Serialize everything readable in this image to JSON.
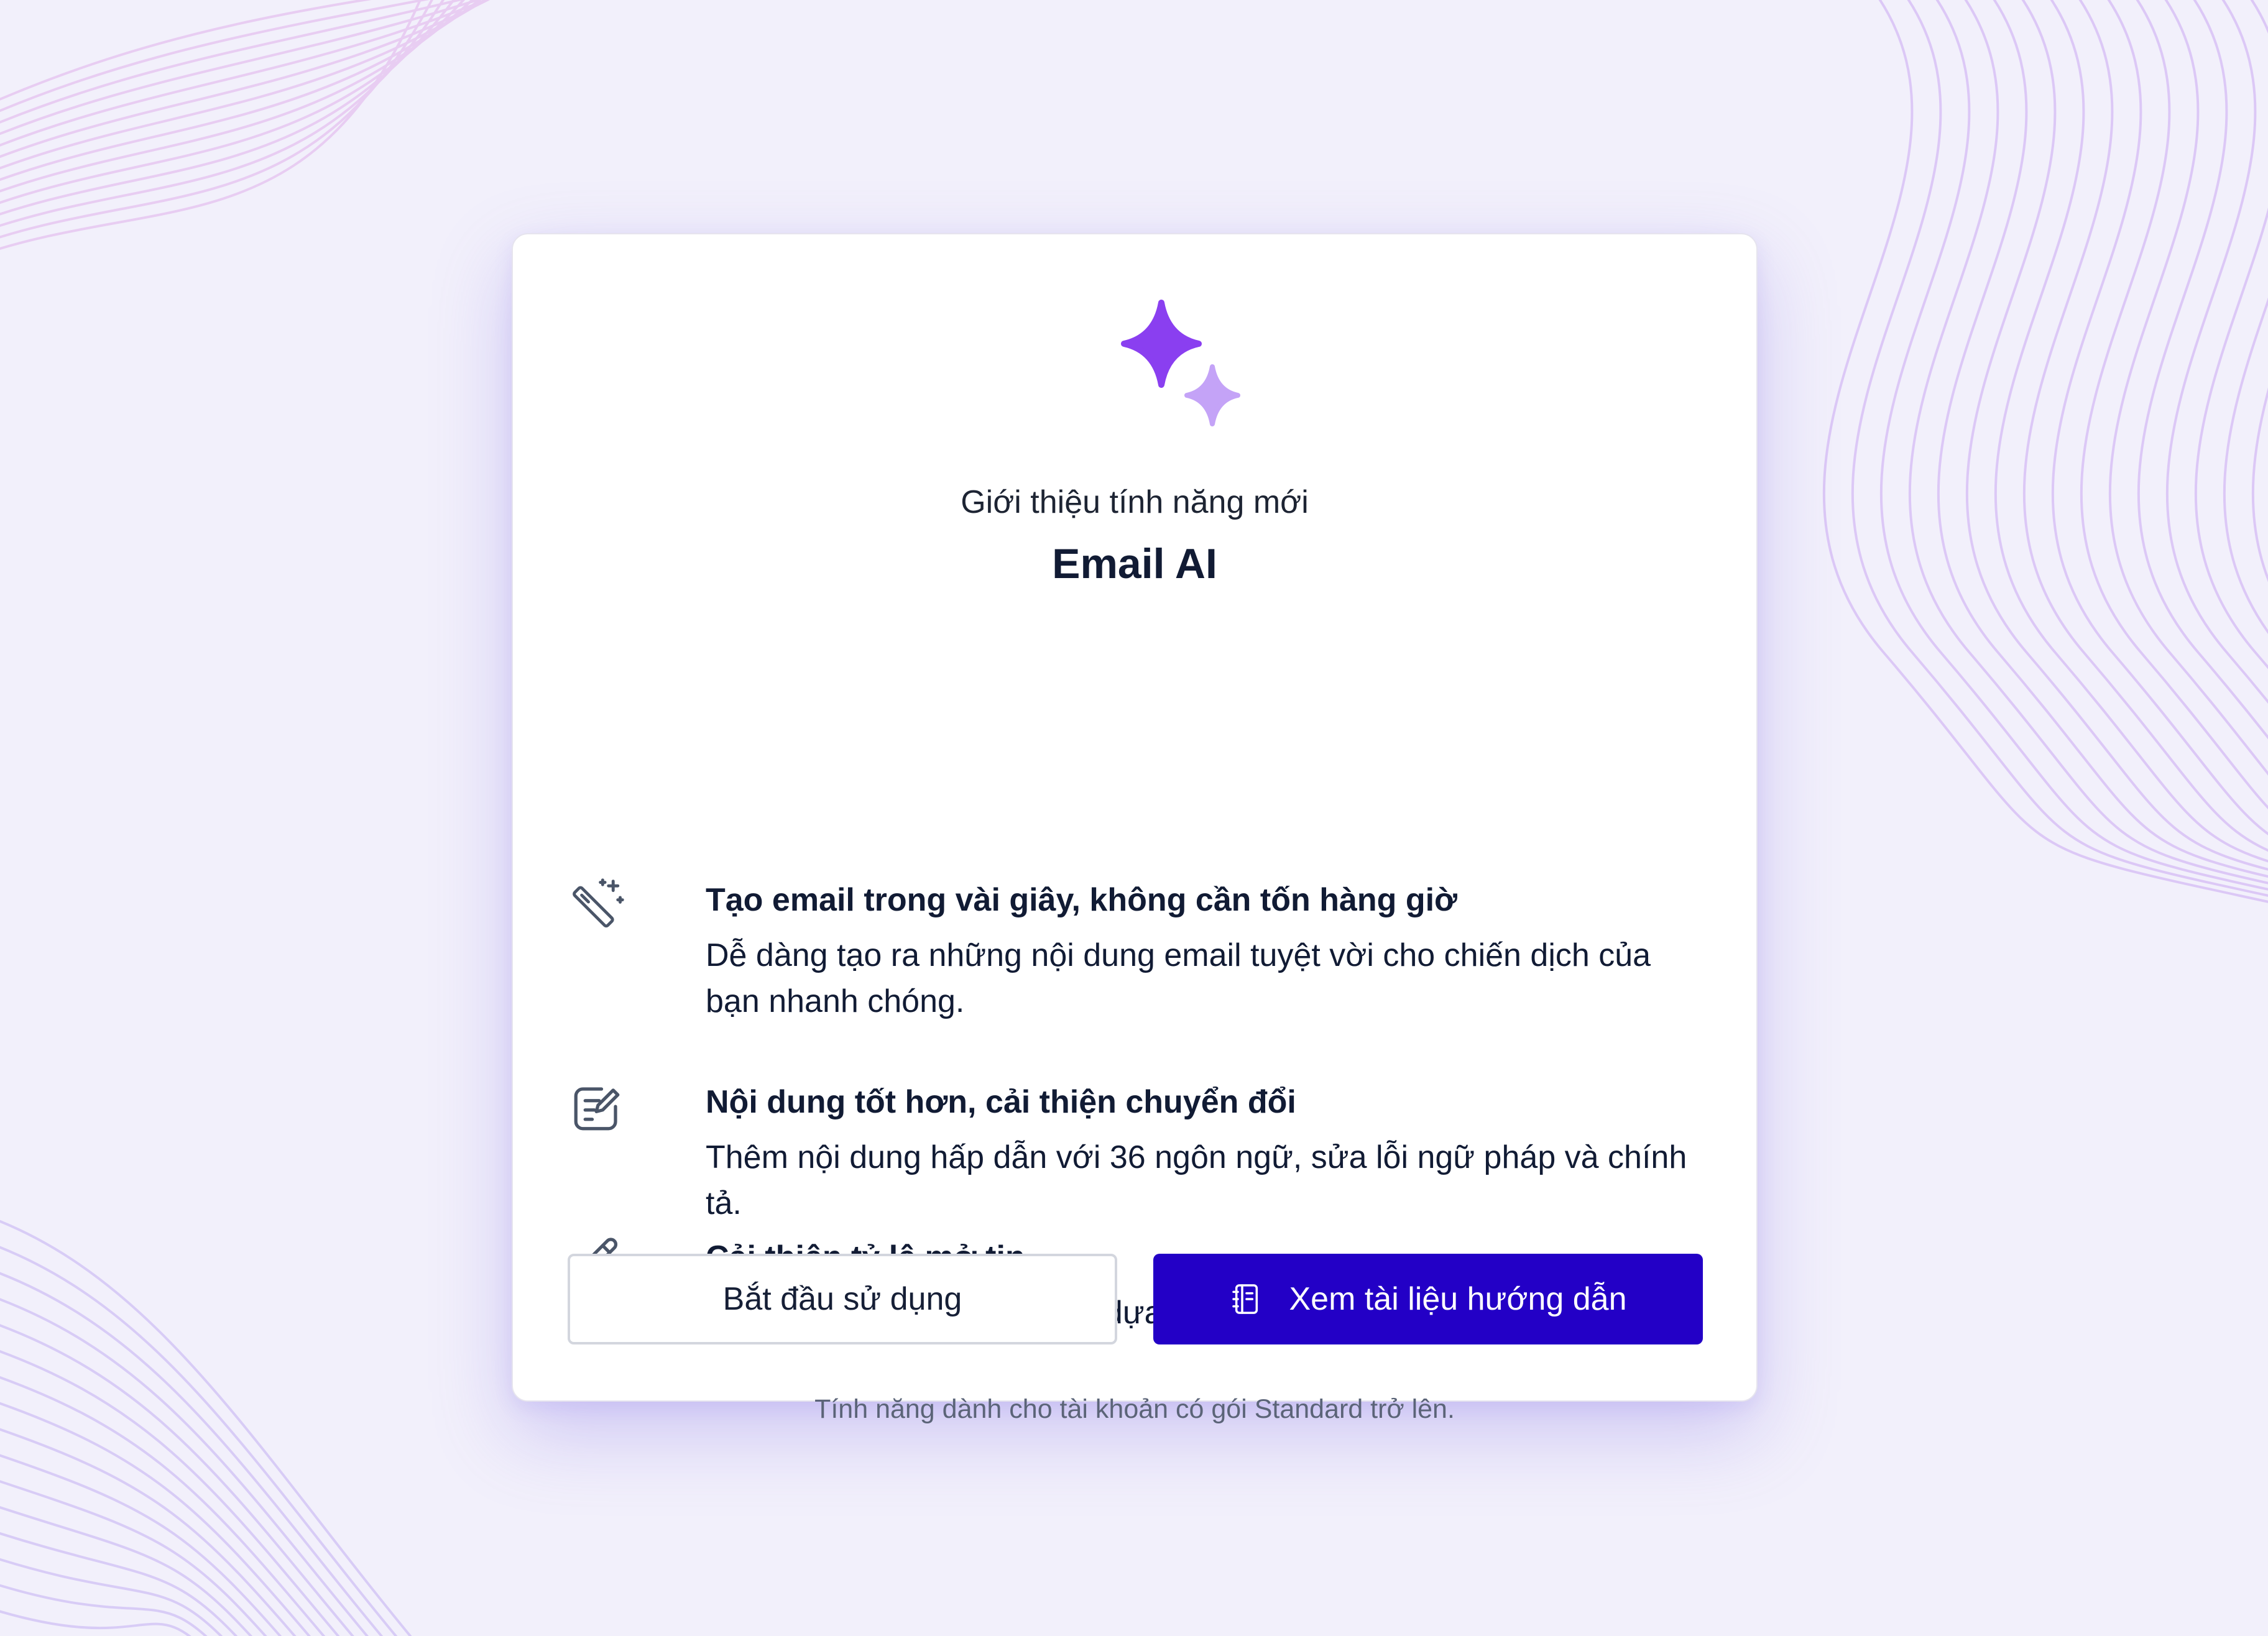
{
  "intro": {
    "eyebrow": "Giới thiệu tính năng mới",
    "title": "Email AI"
  },
  "features": [
    {
      "icon": "magic-wand-icon",
      "title": "Tạo email trong vài giây, không cần tốn hàng giờ",
      "description": "Dễ dàng tạo ra những nội dung email tuyệt vời cho chiến dịch của bạn nhanh chóng."
    },
    {
      "icon": "edit-document-icon",
      "title": "Nội dung tốt hơn, cải thiện chuyển đổi",
      "description": "Thêm nội dung hấp dẫn với 36 ngôn ngữ, sửa lỗi ngữ pháp và chính tả."
    },
    {
      "icon": "pencil-icon",
      "title": "Cải thiện tỷ lệ mở tin",
      "description": "Tự động tạo tiêu đề thu hút dựa trên nội dung email của bạn."
    }
  ],
  "note": "Tính năng dành cho tài khoản có gói Standard trở lên.",
  "actions": {
    "start_label": "Bắt đầu sử dụng",
    "docs_label": "Xem tài liệu hướng dẫn",
    "docs_icon": "notebook-icon"
  },
  "colors": {
    "background": "#f2f0fb",
    "primary": "#2300c6",
    "sparkle_main": "#8a3ff0",
    "sparkle_secondary": "#c4a3f7",
    "text_dark": "#111b34",
    "text_muted": "#5b6478"
  }
}
